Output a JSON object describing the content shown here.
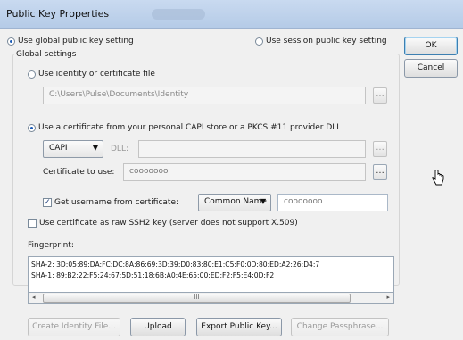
{
  "window": {
    "title": "Public Key Properties"
  },
  "mode": {
    "use_global_label": "Use global public key setting",
    "use_session_label": "Use session public key setting",
    "selected": "global"
  },
  "global_settings": {
    "group_label": "Global settings",
    "identity_file": {
      "radio_label": "Use identity or certificate file",
      "path_value": "C:\\Users\\Pulse\\Documents\\Identity",
      "browse_label": "..."
    },
    "capi": {
      "radio_label": "Use a certificate from your personal CAPI store or a PKCS #11 provider DLL",
      "provider_value": "CAPI",
      "dll_label": "DLL:",
      "dll_value": "",
      "dll_browse_label": "...",
      "cert_label": "Certificate to use:",
      "cert_value": "cooooooo",
      "cert_browse_label": "..."
    },
    "username": {
      "checkbox_label": "Get username from certificate:",
      "checked": true,
      "field_value": "Common Name",
      "result_value": "cooooooo"
    },
    "raw_ssh2": {
      "checkbox_label": "Use certificate as raw SSH2 key (server does not support X.509)",
      "checked": false
    },
    "fingerprint": {
      "label": "Fingerprint:",
      "sha2": "SHA-2: 3D:05:89:DA:FC:DC:8A:86:69:3D:39:D0:83:80:E1:C5:F0:0D:80:ED:A2:26:D4:7",
      "sha1": "SHA-1: 89:B2:22:F5:24:67:5D:51:18:6B:A0:4E:65:00:ED:F2:F5:E4:0D:F2",
      "scroll_left": "◂",
      "scroll_right": "▸",
      "scroll_thumb": "III"
    }
  },
  "buttons": {
    "create_identity": "Create Identity File...",
    "upload": "Upload",
    "export_public_key": "Export Public Key...",
    "change_passphrase": "Change Passphrase...",
    "ok": "OK",
    "cancel": "Cancel"
  },
  "icons": {
    "dropdown": "chevron-down-icon",
    "checkmark": "checkmark-icon",
    "cursor": "hand-cursor-icon"
  }
}
